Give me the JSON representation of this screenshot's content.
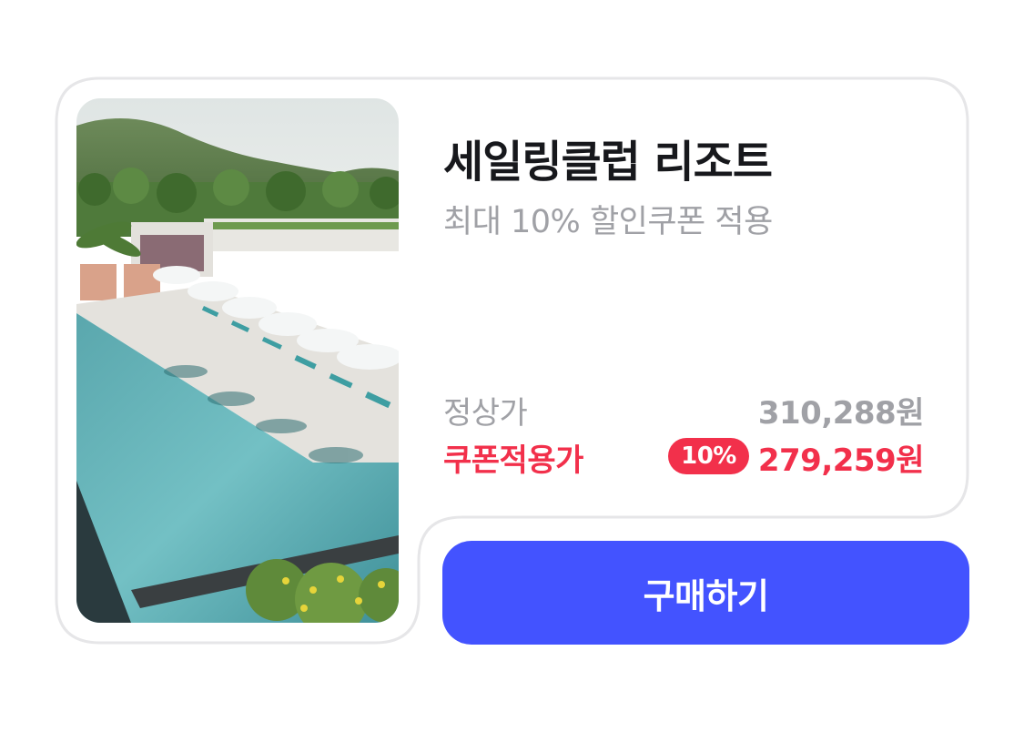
{
  "product": {
    "name": "세일링클럽 리조트",
    "subtitle": "최대 10% 할인쿠폰 적용",
    "image_alt": "resort-pool-photo"
  },
  "pricing": {
    "regular_label": "정상가",
    "regular_price": "310,288원",
    "coupon_label": "쿠폰적용가",
    "discount_badge": "10%",
    "coupon_price": "279,259원"
  },
  "actions": {
    "buy_label": "구매하기"
  },
  "colors": {
    "accent_red": "#f2304b",
    "button_blue": "#4353ff",
    "muted_text": "#a0a1a6",
    "title_text": "#17181c",
    "border": "#e6e6e8"
  }
}
